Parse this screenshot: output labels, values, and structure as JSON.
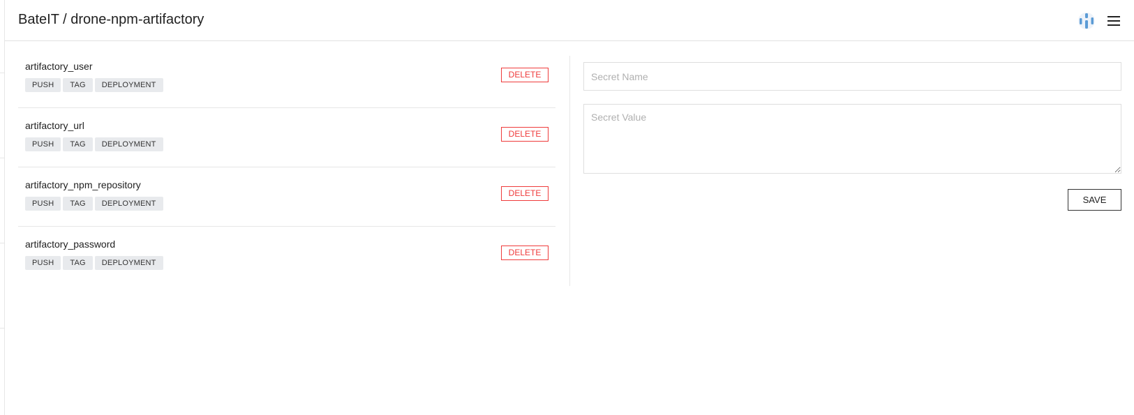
{
  "header": {
    "breadcrumb": "BateIT / drone-npm-artifactory",
    "logo_icon": "drone-logo-icon",
    "menu_icon": "hamburger-menu-icon"
  },
  "colors": {
    "delete": "#ef3b3b",
    "tag_bg": "#e8eaed",
    "logo_blue": "#5b9bd5"
  },
  "secrets": [
    {
      "name": "artifactory_user",
      "events": [
        "PUSH",
        "TAG",
        "DEPLOYMENT"
      ],
      "delete_label": "DELETE"
    },
    {
      "name": "artifactory_url",
      "events": [
        "PUSH",
        "TAG",
        "DEPLOYMENT"
      ],
      "delete_label": "DELETE"
    },
    {
      "name": "artifactory_npm_repository",
      "events": [
        "PUSH",
        "TAG",
        "DEPLOYMENT"
      ],
      "delete_label": "DELETE"
    },
    {
      "name": "artifactory_password",
      "events": [
        "PUSH",
        "TAG",
        "DEPLOYMENT"
      ],
      "delete_label": "DELETE"
    }
  ],
  "form": {
    "name_placeholder": "Secret Name",
    "name_value": "",
    "value_placeholder": "Secret Value",
    "value_value": "",
    "save_label": "SAVE"
  }
}
